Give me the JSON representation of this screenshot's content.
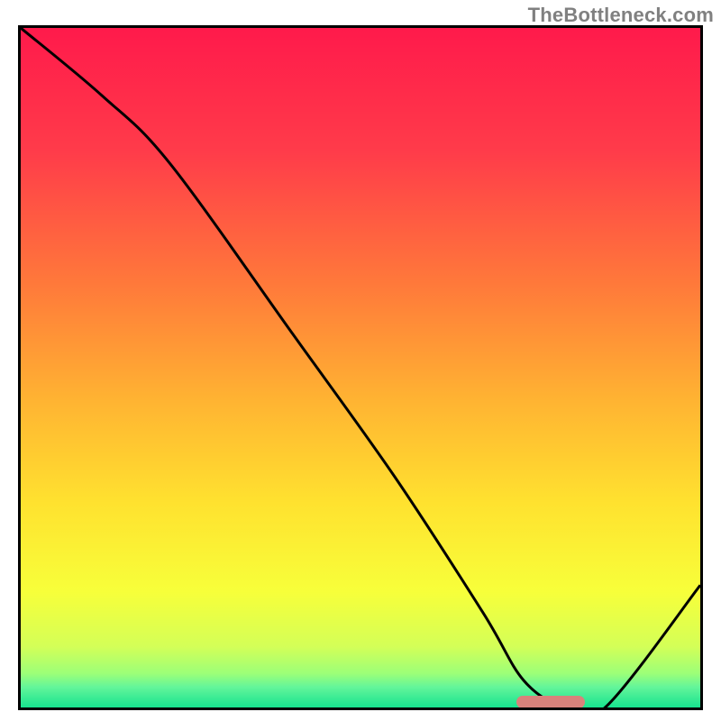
{
  "watermark": "TheBottleneck.com",
  "chart_data": {
    "type": "line",
    "title": "",
    "xlabel": "",
    "ylabel": "",
    "xlim": [
      0,
      100
    ],
    "ylim": [
      0,
      100
    ],
    "grid": false,
    "series": [
      {
        "name": "bottleneck-curve",
        "x": [
          0,
          12,
          22,
          40,
          55,
          68,
          74,
          80,
          86,
          100
        ],
        "y": [
          100,
          90,
          80,
          55,
          34,
          14,
          4,
          0,
          0,
          18
        ]
      }
    ],
    "marker": {
      "x_start": 73,
      "x_end": 83,
      "y": 0
    },
    "gradient_stops": [
      {
        "pct": 0,
        "color": "#ff1a4b"
      },
      {
        "pct": 18,
        "color": "#ff3b4a"
      },
      {
        "pct": 38,
        "color": "#ff7a3a"
      },
      {
        "pct": 55,
        "color": "#ffb432"
      },
      {
        "pct": 70,
        "color": "#ffe22f"
      },
      {
        "pct": 83,
        "color": "#f7ff3a"
      },
      {
        "pct": 91,
        "color": "#d4ff57"
      },
      {
        "pct": 95,
        "color": "#9cff78"
      },
      {
        "pct": 97,
        "color": "#63f59a"
      },
      {
        "pct": 100,
        "color": "#17e38f"
      }
    ]
  }
}
